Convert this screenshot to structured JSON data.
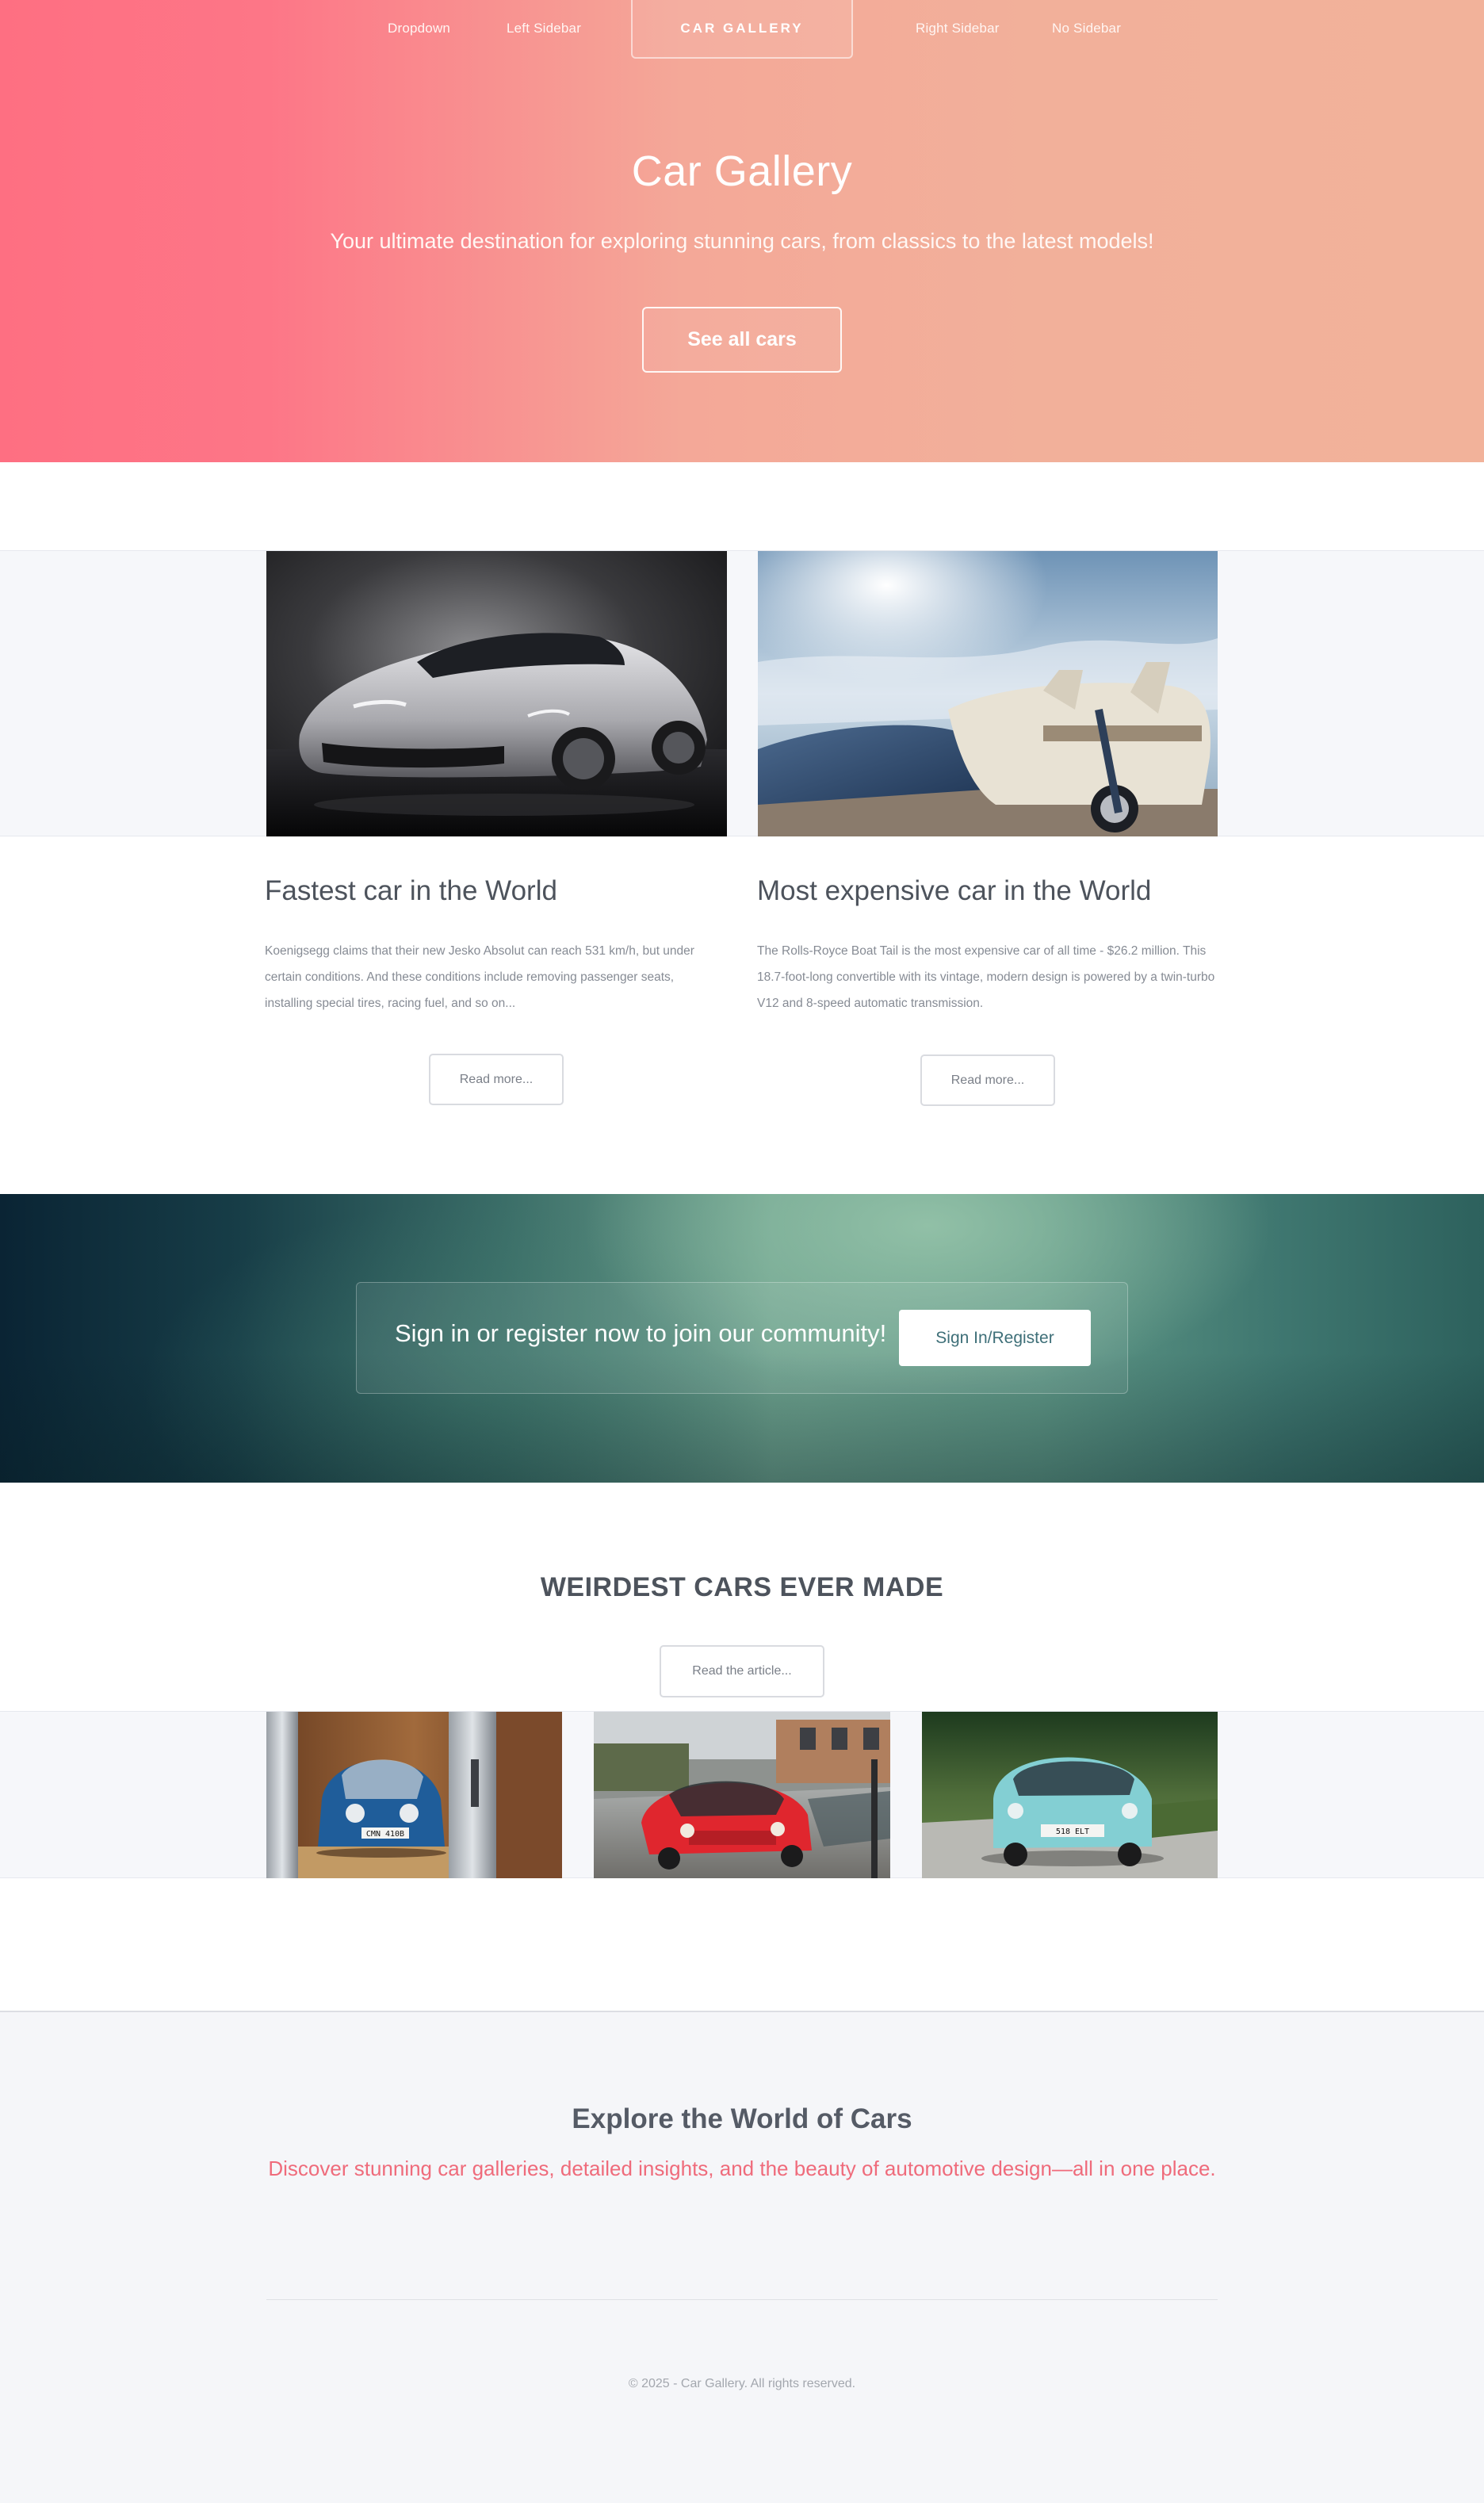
{
  "nav": {
    "links": [
      "Dropdown",
      "Left Sidebar"
    ],
    "brand": "CAR GALLERY",
    "links_right": [
      "Right Sidebar",
      "No Sidebar"
    ]
  },
  "hero": {
    "title": "Car Gallery",
    "subtitle": "Your ultimate destination for exploring stunning cars, from classics to the latest models!",
    "button": "See all cars"
  },
  "featured": [
    {
      "title": "Fastest car in the World",
      "text": "Koenigsegg claims that their new Jesko Absolut can reach 531 km/h, but under certain conditions. And these conditions include removing passenger seats, installing special tires, racing fuel, and so on...",
      "button": "Read more...",
      "image": "silver-hypercar-photo"
    },
    {
      "title": "Most expensive car in the World",
      "text": "The Rolls-Royce Boat Tail is the most expensive car of all time - $26.2 million. This 18.7-foot-long convertible with its vintage, modern design is powered by a twin-turbo V12 and 8-speed automatic transmission.",
      "button": "Read more...",
      "image": "blue-convertible-photo"
    }
  ],
  "cta": {
    "text": "Sign in or register now to join our community!",
    "button": "Sign In/Register"
  },
  "weird": {
    "title": "WEIRDEST CARS EVER MADE",
    "button": "Read the article...",
    "photos": [
      {
        "image": "blue-microcar-in-elevator-photo",
        "plate": "CMN 410B"
      },
      {
        "image": "red-three-wheeler-photo",
        "plate": ""
      },
      {
        "image": "teal-bubble-car-photo",
        "plate": "518 ELT"
      }
    ]
  },
  "footer": {
    "title": "Explore the World of Cars",
    "subtitle": "Discover stunning car galleries, detailed insights, and the beauty of automotive design—all in one place.",
    "copyright": "© 2025 - Car Gallery. All rights reserved."
  },
  "colors": {
    "hero_left": "#fe6f82",
    "hero_right": "#f2b29a",
    "accent_pink": "#ef6b7b",
    "cta_teal": "#3e6f78"
  }
}
